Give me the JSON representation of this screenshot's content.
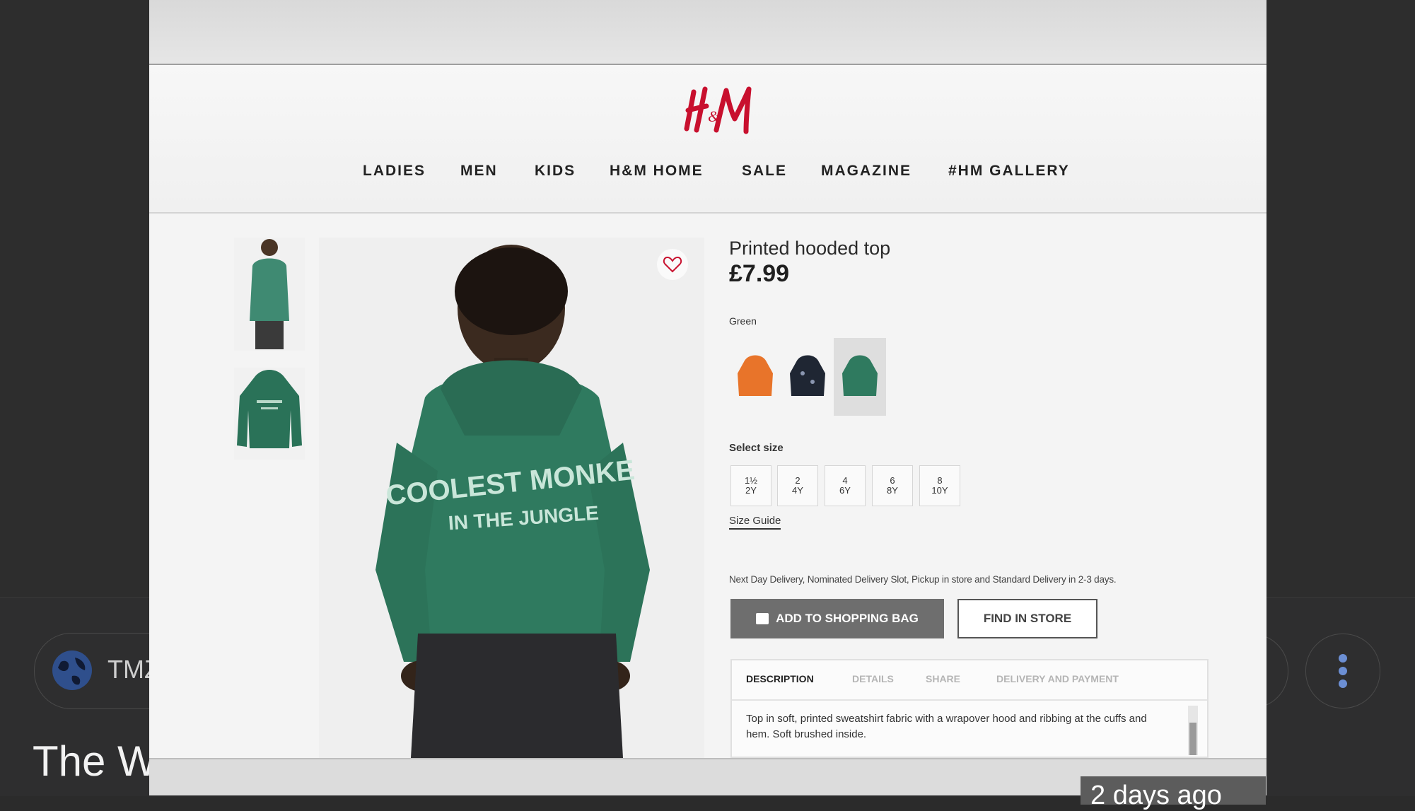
{
  "viewer": {
    "source_name": "TMZ",
    "page_heading": "The W",
    "timestamp": "2 days ago"
  },
  "store": {
    "logo": "H&M",
    "nav": [
      "LADIES",
      "MEN",
      "KIDS",
      "H&M HOME",
      "SALE",
      "MAGAZINE",
      "#HM GALLERY"
    ]
  },
  "product": {
    "title": "Printed hooded top",
    "price": "£7.99",
    "color_label": "Green",
    "swatches": [
      "orange",
      "navy",
      "green"
    ],
    "selected_swatch": "green",
    "size_label": "Select size",
    "sizes": [
      {
        "top": "1½",
        "bottom": "2Y"
      },
      {
        "top": "2",
        "bottom": "4Y"
      },
      {
        "top": "4",
        "bottom": "6Y"
      },
      {
        "top": "6",
        "bottom": "8Y"
      },
      {
        "top": "8",
        "bottom": "10Y"
      }
    ],
    "size_guide": "Size Guide",
    "delivery_note": "Next Day Delivery, Nominated Delivery Slot, Pickup in store and Standard Delivery in 2-3 days.",
    "add_to_bag": "ADD TO SHOPPING BAG",
    "find_in_store": "FIND IN STORE",
    "tabs": [
      "DESCRIPTION",
      "DETAILS",
      "SHARE",
      "DELIVERY AND PAYMENT"
    ],
    "active_tab": "DESCRIPTION",
    "description": "Top in soft, printed sweatshirt fabric with a wrapover hood and ribbing at the cuffs and hem. Soft brushed inside.",
    "hoodie_print": [
      "COOLEST MONKE",
      "IN THE JUNGLE"
    ]
  },
  "colors": {
    "brand_red": "#c8102e",
    "hoodie_green": "#2f7a5f",
    "button_gray": "#6e6e6e"
  }
}
